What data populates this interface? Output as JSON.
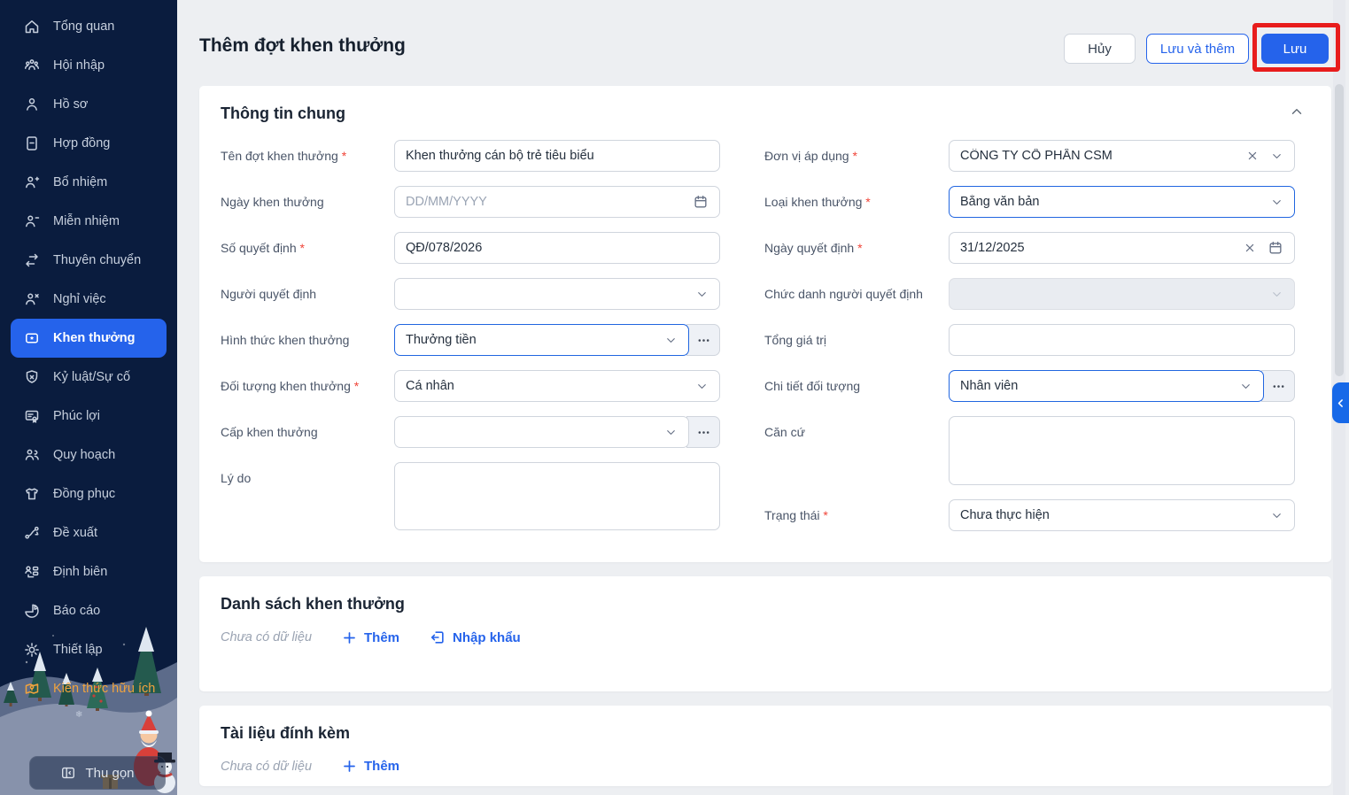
{
  "colors": {
    "accent_blue": "#2563eb",
    "sidebar_bg": "#0a1c3e",
    "annotation_red": "#e81c1c",
    "highlight_orange": "#f1a33d",
    "required_red": "#f04438"
  },
  "sidebar": {
    "items": [
      {
        "label": "Tổng quan",
        "icon": "home-icon"
      },
      {
        "label": "Hội nhập",
        "icon": "onboarding-icon"
      },
      {
        "label": "Hồ sơ",
        "icon": "profile-icon"
      },
      {
        "label": "Hợp đồng",
        "icon": "contract-icon"
      },
      {
        "label": "Bổ nhiệm",
        "icon": "appointment-icon"
      },
      {
        "label": "Miễn nhiệm",
        "icon": "dismissal-icon"
      },
      {
        "label": "Thuyên chuyển",
        "icon": "transfer-icon"
      },
      {
        "label": "Nghỉ việc",
        "icon": "resignation-icon"
      },
      {
        "label": "Khen thưởng",
        "icon": "reward-icon",
        "active": true
      },
      {
        "label": "Kỷ luật/Sự cố",
        "icon": "discipline-icon"
      },
      {
        "label": "Phúc lợi",
        "icon": "benefits-icon"
      },
      {
        "label": "Quy hoạch",
        "icon": "planning-icon"
      },
      {
        "label": "Đồng phục",
        "icon": "uniform-icon"
      },
      {
        "label": "Đề xuất",
        "icon": "proposal-icon"
      },
      {
        "label": "Định biên",
        "icon": "headcount-icon"
      },
      {
        "label": "Báo cáo",
        "icon": "report-icon"
      },
      {
        "label": "Thiết lập",
        "icon": "settings-icon"
      },
      {
        "label": "Kiến thức hữu ích",
        "icon": "knowledge-icon",
        "highlight": "orange"
      }
    ],
    "collapse_label": "Thu gọn"
  },
  "header": {
    "title": "Thêm đợt khen thưởng",
    "cancel_label": "Hủy",
    "save_and_add_label": "Lưu và thêm",
    "save_label": "Lưu"
  },
  "general_info": {
    "title": "Thông tin chung",
    "left_fields": [
      {
        "label": "Tên đợt khen thưởng",
        "value": "Khen thưởng cán bộ trẻ tiêu biểu"
      },
      {
        "label": "Ngày khen thưởng",
        "placeholder": "DD/MM/YYYY"
      },
      {
        "label": "Số quyết định",
        "value": "QĐ/078/2026"
      },
      {
        "label": "Người quyết định",
        "value": ""
      },
      {
        "label": "Hình thức khen thưởng",
        "value": "Thưởng tiền"
      },
      {
        "label": "Đối tượng khen thưởng",
        "value": "Cá nhân"
      },
      {
        "label": "Cấp khen thưởng",
        "value": ""
      },
      {
        "label": "Lý do",
        "value": ""
      }
    ],
    "right_fields": [
      {
        "label": "Đơn vị áp dụng",
        "value": "CÔNG TY CỔ PHẦN CSM"
      },
      {
        "label": "Loại khen thưởng",
        "value": "Bằng văn bản"
      },
      {
        "label": "Ngày quyết định",
        "value": "31/12/2025"
      },
      {
        "label": "Chức danh người quyết định",
        "value": ""
      },
      {
        "label": "Tổng giá trị",
        "value": ""
      },
      {
        "label": "Chi tiết đối tượng",
        "value": "Nhân viên"
      },
      {
        "label": "Căn cứ",
        "value": ""
      },
      {
        "label": "Trạng thái",
        "value": "Chưa thực hiện"
      }
    ]
  },
  "reward_list": {
    "title": "Danh sách khen thưởng",
    "empty_text": "Chưa có dữ liệu",
    "add_label": "Thêm",
    "import_label": "Nhập khẩu"
  },
  "attachments": {
    "title": "Tài liệu đính kèm",
    "empty_text": "Chưa có dữ liệu",
    "add_label": "Thêm"
  }
}
